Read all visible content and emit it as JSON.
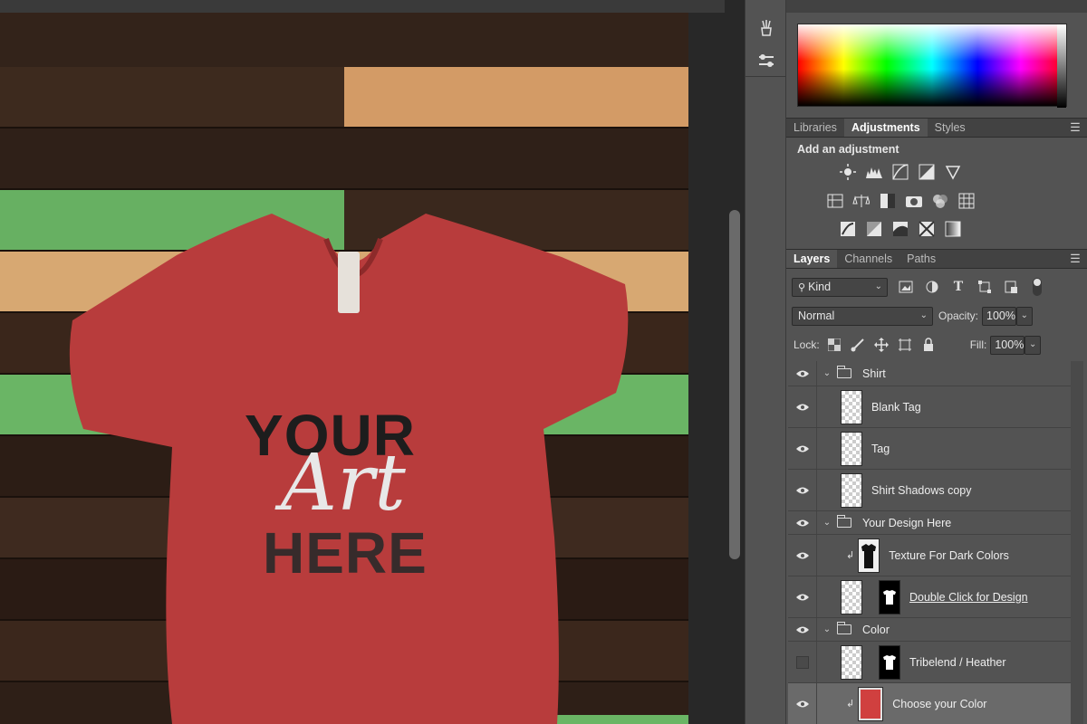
{
  "colors": {
    "shirt": "#b83c3c",
    "wood_dark": "#3a271c",
    "wood_light": "#d9a46a",
    "wood_green": "#6cb366",
    "panel_bg": "#535353"
  },
  "canvas": {
    "design_text": {
      "line1": "YOUR",
      "script": "Art",
      "line2": "HERE"
    }
  },
  "tools": [
    "brush-icon",
    "sliders-icon"
  ],
  "adjustments_panel": {
    "tabs": [
      {
        "label": "Libraries",
        "active": false
      },
      {
        "label": "Adjustments",
        "active": true
      },
      {
        "label": "Styles",
        "active": false
      }
    ],
    "title": "Add an adjustment",
    "icon_rows": [
      [
        "brightness-icon",
        "levels-icon",
        "curves-icon",
        "exposure-icon",
        "triangle-icon"
      ],
      [
        "vibrance-icon",
        "color-balance-icon",
        "black-white-icon",
        "camera-icon",
        "channel-mixer-icon",
        "color-lookup-icon"
      ],
      [
        "invert-icon",
        "posterize-icon",
        "threshold-icon",
        "selective-color-icon",
        "gradient-map-icon"
      ]
    ]
  },
  "layers_panel": {
    "tabs": [
      {
        "label": "Layers",
        "active": true
      },
      {
        "label": "Channels",
        "active": false
      },
      {
        "label": "Paths",
        "active": false
      }
    ],
    "filter_kind": "Kind",
    "blend_mode": "Normal",
    "opacity_label": "Opacity:",
    "opacity_value": "100%",
    "lock_label": "Lock:",
    "fill_label": "Fill:",
    "fill_value": "100%",
    "layers": [
      {
        "name": "Shirt",
        "type": "group"
      },
      {
        "name": "Blank Tag",
        "type": "layer"
      },
      {
        "name": "Tag",
        "type": "layer"
      },
      {
        "name": "Shirt Shadows copy",
        "type": "layer"
      },
      {
        "name": "Your Design Here",
        "type": "group"
      },
      {
        "name": "Texture For Dark Colors",
        "type": "clipped"
      },
      {
        "name": "Double Click for Design",
        "type": "smart"
      },
      {
        "name": "Color",
        "type": "group"
      },
      {
        "name": "Tribelend / Heather",
        "type": "masked",
        "hidden": true
      },
      {
        "name": "Choose your Color",
        "type": "fill",
        "selected": true
      }
    ]
  }
}
